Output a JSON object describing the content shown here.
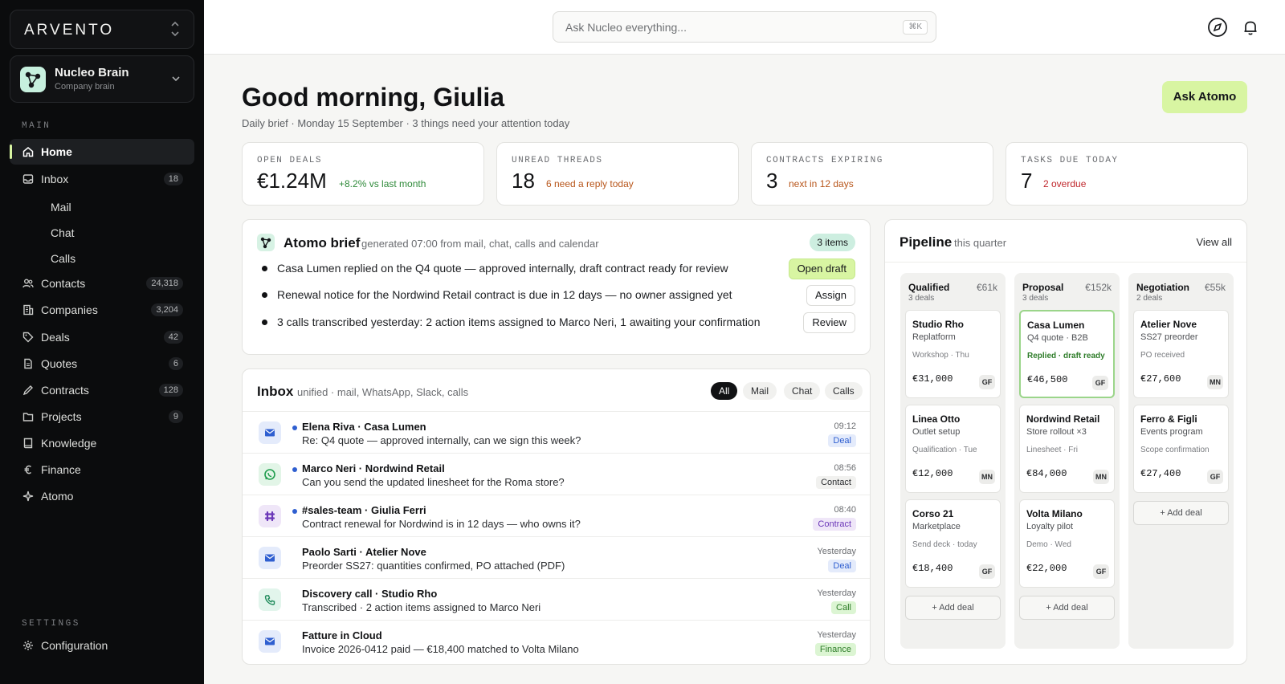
{
  "brand": {
    "name": "ARVENTO"
  },
  "workspace": {
    "name": "Nucleo Brain",
    "subtitle": "Company brain"
  },
  "sidebar": {
    "main_label": "MAIN",
    "settings_label": "SETTINGS",
    "items": [
      {
        "label": "Home",
        "count": ""
      },
      {
        "label": "Inbox",
        "count": "18"
      },
      {
        "label": "Contacts",
        "count": "24,318"
      },
      {
        "label": "Companies",
        "count": "3,204"
      },
      {
        "label": "Deals",
        "count": "42"
      },
      {
        "label": "Quotes",
        "count": "6"
      },
      {
        "label": "Contracts",
        "count": "128"
      },
      {
        "label": "Projects",
        "count": "9"
      },
      {
        "label": "Knowledge",
        "count": ""
      },
      {
        "label": "Finance",
        "count": ""
      },
      {
        "label": "Atomo",
        "count": ""
      }
    ],
    "inbox_sub": [
      "Mail",
      "Chat",
      "Calls"
    ],
    "configuration": "Configuration"
  },
  "search": {
    "placeholder": "Ask Nucleo everything...",
    "shortcut": "⌘K"
  },
  "header": {
    "greeting": "Good morning, Giulia",
    "brief_line": "Daily brief · Monday 15 September · 3 things need your attention today",
    "ask_button": "Ask Atomo"
  },
  "kpis": [
    {
      "label": "OPEN DEALS",
      "value": "€1.24M",
      "note": "+8.2% vs last month",
      "note_color": "#2f8a3a"
    },
    {
      "label": "UNREAD THREADS",
      "value": "18",
      "note": "6 need a reply today",
      "note_color": "#b8561b"
    },
    {
      "label": "CONTRACTS EXPIRING",
      "value": "3",
      "note": "next in 12 days",
      "note_color": "#b8561b"
    },
    {
      "label": "TASKS DUE TODAY",
      "value": "7",
      "note": "2 overdue",
      "note_color": "#c0282d"
    }
  ],
  "brief": {
    "title": "Atomo brief",
    "subtitle": "generated 07:00 from mail, chat, calls and calendar",
    "badge": "3 items",
    "items": [
      {
        "text": "Casa Lumen replied on the Q4 quote — approved internally, draft contract ready for review",
        "action": "Open draft"
      },
      {
        "text": "Renewal notice for the Nordwind Retail contract is due in 12 days — no owner assigned yet",
        "action": "Assign"
      },
      {
        "text": "3 calls transcribed yesterday: 2 action items assigned to Marco Neri, 1 awaiting your confirmation",
        "action": "Review"
      }
    ]
  },
  "inbox": {
    "title": "Inbox",
    "subtitle": "unified · mail, WhatsApp, Slack, calls",
    "filters": [
      "All",
      "Mail",
      "Chat",
      "Calls"
    ],
    "messages": [
      {
        "channel": "mail",
        "from": "Elena Riva · Casa Lumen",
        "preview": "Re: Q4 quote — approved internally, can we sign this week?",
        "time": "09:12",
        "tag": "Deal",
        "unread": true
      },
      {
        "channel": "whatsapp",
        "from": "Marco Neri · Nordwind Retail",
        "preview": "Can you send the updated linesheet for the Roma store?",
        "time": "08:56",
        "tag": "Contact",
        "unread": true
      },
      {
        "channel": "slack",
        "from": "#sales-team · Giulia Ferri",
        "preview": "Contract renewal for Nordwind is in 12 days — who owns it?",
        "time": "08:40",
        "tag": "Contract",
        "unread": true
      },
      {
        "channel": "mail",
        "from": "Paolo Sarti · Atelier Nove",
        "preview": "Preorder SS27: quantities confirmed, PO attached (PDF)",
        "time": "Yesterday",
        "tag": "Deal",
        "unread": false
      },
      {
        "channel": "call",
        "from": "Discovery call · Studio Rho",
        "preview": "Transcribed · 2 action items assigned to Marco Neri",
        "time": "Yesterday",
        "tag": "Call",
        "unread": false
      },
      {
        "channel": "mail",
        "from": "Fatture in Cloud",
        "preview": "Invoice 2026-0412 paid — €18,400 matched to Volta Milano",
        "time": "Yesterday",
        "tag": "Finance",
        "unread": false
      }
    ]
  },
  "pipeline": {
    "title": "Pipeline",
    "subtitle": "this quarter",
    "view_all": "View all",
    "add_deal": "+ Add deal",
    "columns": [
      {
        "name": "Qualified",
        "total": "€61k",
        "count": "3 deals",
        "deals": [
          {
            "name": "Studio Rho",
            "desc": "Replatform",
            "step": "Workshop · Thu",
            "value": "€31,000",
            "owner": "GF"
          },
          {
            "name": "Linea Otto",
            "desc": "Outlet setup",
            "step": "Qualification · Tue",
            "value": "€12,000",
            "owner": "MN"
          },
          {
            "name": "Corso 21",
            "desc": "Marketplace",
            "step": "Send deck · today",
            "value": "€18,400",
            "owner": "GF"
          }
        ]
      },
      {
        "name": "Proposal",
        "total": "€152k",
        "count": "3 deals",
        "deals": [
          {
            "name": "Casa Lumen",
            "desc": "Q4 quote · B2B",
            "step": "Replied · draft ready",
            "value": "€46,500",
            "owner": "GF"
          },
          {
            "name": "Nordwind Retail",
            "desc": "Store rollout ×3",
            "step": "Linesheet · Fri",
            "value": "€84,000",
            "owner": "MN"
          },
          {
            "name": "Volta Milano",
            "desc": "Loyalty pilot",
            "step": "Demo · Wed",
            "value": "€22,000",
            "owner": "GF"
          }
        ]
      },
      {
        "name": "Negotiation",
        "total": "€55k",
        "count": "2 deals",
        "deals": [
          {
            "name": "Atelier Nove",
            "desc": "SS27 preorder",
            "step": "PO received",
            "value": "€27,600",
            "owner": "MN"
          },
          {
            "name": "Ferro & Figli",
            "desc": "Events program",
            "step": "Scope confirmation",
            "value": "€27,400",
            "owner": "GF"
          }
        ]
      }
    ]
  }
}
